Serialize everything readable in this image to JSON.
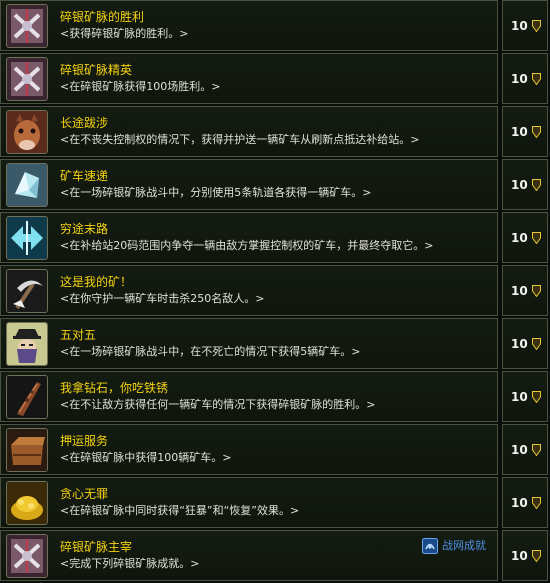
{
  "achievements": [
    {
      "title": "碎银矿脉的胜利",
      "desc": "<获得碎银矿脉的胜利。>",
      "points": "10",
      "icon": "battleground-icon"
    },
    {
      "title": "碎银矿脉精英",
      "desc": "<在碎银矿脉获得100场胜利。>",
      "points": "10",
      "icon": "battleground-icon"
    },
    {
      "title": "长途跋涉",
      "desc": "<在不丧失控制权的情况下，获得并护送一辆矿车从刷新点抵达补给站。>",
      "points": "10",
      "icon": "mount-icon"
    },
    {
      "title": "矿车速递",
      "desc": "<在一场碎银矿脉战斗中，分别使用5条轨道各获得一辆矿车。>",
      "points": "10",
      "icon": "crystal-icon"
    },
    {
      "title": "穷途末路",
      "desc": "<在补给站20码范围内争夺一辆由敌方掌握控制权的矿车，并最终夺取它。>",
      "points": "10",
      "icon": "arrows-icon"
    },
    {
      "title": "这是我的矿！",
      "desc": "<在你守护一辆矿车时击杀250名敌人。>",
      "points": "10",
      "icon": "pickaxe-icon"
    },
    {
      "title": "五对五",
      "desc": "<在一场碎银矿脉战斗中，在不死亡的情况下获得5辆矿车。>",
      "points": "10",
      "icon": "bandit-icon"
    },
    {
      "title": "我拿钻石，你吃铁锈",
      "desc": "<在不让敌方获得任何一辆矿车的情况下获得碎银矿脉的胜利。>",
      "points": "10",
      "icon": "rusty-blade-icon"
    },
    {
      "title": "押运服务",
      "desc": "<在碎银矿脉中获得100辆矿车。>",
      "points": "10",
      "icon": "crate-icon"
    },
    {
      "title": "贪心无罪",
      "desc": "<在碎银矿脉中同时获得“狂暴”和“恢复”效果。>",
      "points": "10",
      "icon": "gold-pile-icon"
    },
    {
      "title": "碎银矿脉主宰",
      "desc": "<完成下列碎银矿脉成就。>",
      "points": "10",
      "icon": "battleground-icon"
    }
  ],
  "footer_link": {
    "label": "战网成就",
    "icon": "battlenet-icon"
  },
  "colors": {
    "title": "#f4d311",
    "desc": "#e0e0d8",
    "link": "#4f8fe0",
    "border": "#4a5240"
  }
}
